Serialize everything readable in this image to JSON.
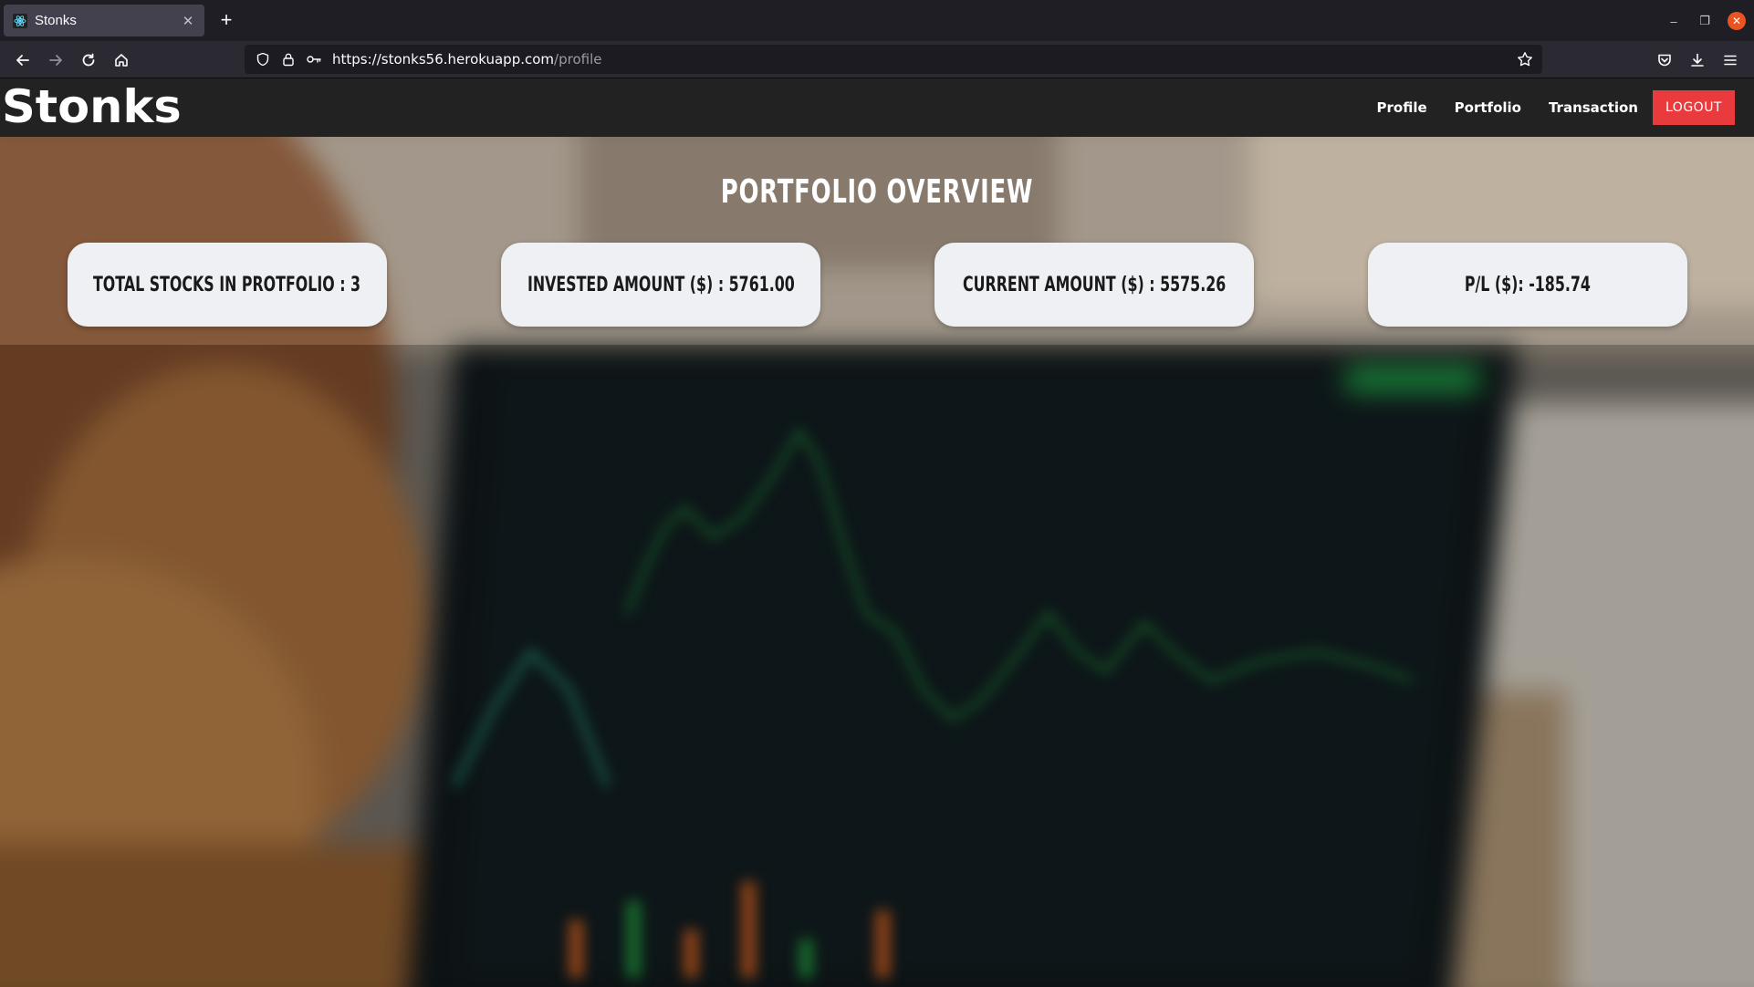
{
  "browser": {
    "tab_title": "Stonks",
    "url_host": "https://stonks56.herokuapp.com",
    "url_path": "/profile"
  },
  "header": {
    "brand": "Stonks",
    "nav": [
      "Profile",
      "Portfolio",
      "Transaction"
    ],
    "logout_label": "LOGOUT"
  },
  "overview": {
    "title": "PORTFOLIO OVERVIEW",
    "cards": [
      {
        "text": "TOTAL STOCKS IN PROTFOLIO : 3"
      },
      {
        "text": "INVESTED AMOUNT ($) : 5761.00"
      },
      {
        "text": "CURRENT AMOUNT ($) : 5575.26"
      },
      {
        "text": "P/L ($): -185.74"
      }
    ]
  },
  "colors": {
    "logout_bg": "#e93b3d",
    "header_bg": "#222222",
    "card_bg": "#eef0f3",
    "chart_line": "#1f8a3a"
  },
  "icons": [
    "react-favicon-icon",
    "back-arrow-icon",
    "forward-arrow-icon",
    "reload-icon",
    "home-icon",
    "shield-icon",
    "lock-icon",
    "key-icon",
    "bookmark-star-icon",
    "pocket-icon",
    "download-icon",
    "menu-icon"
  ]
}
